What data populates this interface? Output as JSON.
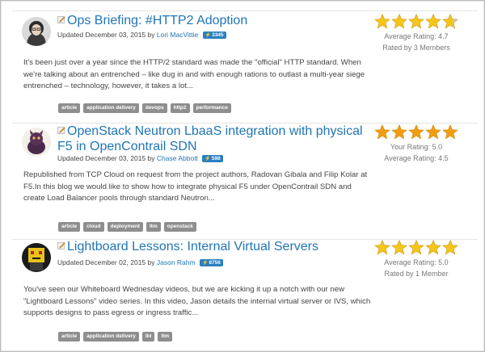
{
  "articles": [
    {
      "title": "Ops Briefing: #HTTP2 Adoption",
      "updated": "Updated December 03, 2015 by",
      "author": "Lori MacVittie",
      "points": "3345",
      "excerpt": "It's been just over a year since the HTTP/2 standard was made the \"official\" HTTP standard. When we're talking about an entrenched – like dug in and with enough rations to outlast a multi-year siege entrenched – technology, however, it takes a lot...",
      "tags": [
        "article",
        "application delivery",
        "devops",
        "http2",
        "performance"
      ],
      "rating_lines": [
        "Average Rating: 4.7",
        "Rated by 3 Members"
      ],
      "star_color": "#f5c518",
      "star_value": 4.7
    },
    {
      "title": "OpenStack Neutron LbaaS integration with physical F5 in OpenContrail SDN",
      "updated": "Updated December 03, 2015 by",
      "author": "Chase Abbott",
      "points": "598",
      "excerpt": "Republished from TCP Cloud on request from the project authors, Radovan Gibala and Filip Kolar at F5.In this blog we would like to show how to integrate physical F5 under OpenContrail SDN and create Load Balancer pools through standard Neutron...",
      "tags": [
        "article",
        "cloud",
        "deployment",
        "ltm",
        "openstack"
      ],
      "rating_lines": [
        "Your Rating: 5.0",
        "Average Rating: 4.5"
      ],
      "star_color": "#f39c12",
      "star_value": 5.0
    },
    {
      "title": "Lightboard Lessons: Internal Virtual Servers",
      "updated": "Updated December 02, 2015 by",
      "author": "Jason Rahm",
      "points": "8756",
      "excerpt": "You've seen our Whiteboard Wednesday videos, but we are kicking it up a notch with our new \"Lightboard Lessons\" video series. In this video, Jason details the internal virtual server or IVS, which supports designs to pass egress or ingress traffic...",
      "tags": [
        "article",
        "application delivery",
        "lbl",
        "ltm"
      ],
      "rating_lines": [
        "Average Rating: 5.0",
        "Rated by 1 Member"
      ],
      "star_color": "#f5c518",
      "star_value": 5.0
    }
  ]
}
